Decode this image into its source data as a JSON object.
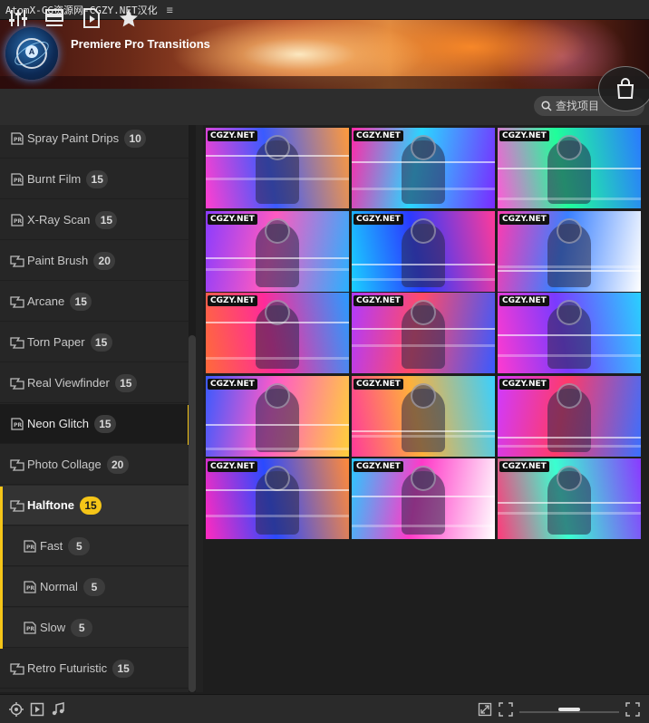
{
  "window": {
    "title": "AtomX-CG资源网-CGZY.NET汉化",
    "menu_icon": "hamburger-icon"
  },
  "banner": {
    "title": "Premiere Pro Transitions",
    "logo_letter": "A"
  },
  "toolbar": {
    "icons": [
      "sliders-icon",
      "list-icon",
      "video-file-icon",
      "star-icon"
    ],
    "search_placeholder": "查找项目",
    "cart_icon": "shopping-bag-icon"
  },
  "sidebar": {
    "items": [
      {
        "label": "Spray Paint Drips",
        "count": "10",
        "icon": "preset-icon"
      },
      {
        "label": "Burnt Film",
        "count": "15",
        "icon": "preset-icon"
      },
      {
        "label": "X-Ray Scan",
        "count": "15",
        "icon": "preset-icon"
      },
      {
        "label": "Paint Brush",
        "count": "20",
        "icon": "transition-icon"
      },
      {
        "label": "Arcane",
        "count": "15",
        "icon": "transition-icon"
      },
      {
        "label": "Torn Paper",
        "count": "15",
        "icon": "transition-icon"
      },
      {
        "label": "Real Viewfinder",
        "count": "15",
        "icon": "transition-icon"
      },
      {
        "label": "Neon Glitch",
        "count": "15",
        "icon": "preset-icon",
        "state": "selected"
      },
      {
        "label": "Photo Collage",
        "count": "20",
        "icon": "transition-icon"
      },
      {
        "label": "Halftone",
        "count": "15",
        "icon": "transition-icon",
        "state": "expanded"
      },
      {
        "label": "Fast",
        "count": "5",
        "icon": "preset-icon",
        "sub": true
      },
      {
        "label": "Normal",
        "count": "5",
        "icon": "preset-icon",
        "sub": true
      },
      {
        "label": "Slow",
        "count": "5",
        "icon": "preset-icon",
        "sub": true
      },
      {
        "label": "Retro Futuristic",
        "count": "15",
        "icon": "transition-icon"
      }
    ]
  },
  "grid": {
    "watermark": "CGZY.NET",
    "thumbnails": [
      {
        "palette": [
          "#ff3fd0",
          "#3a5bff",
          "#ff9a3c"
        ]
      },
      {
        "palette": [
          "#ff2aa8",
          "#2ad6ff",
          "#7a2aff"
        ]
      },
      {
        "palette": [
          "#ff5ad8",
          "#20ff9a",
          "#2a7aff"
        ]
      },
      {
        "palette": [
          "#8a3cff",
          "#ff5ac0",
          "#2ab0ff"
        ]
      },
      {
        "palette": [
          "#1ad0ff",
          "#2a3aff",
          "#ff3a9a"
        ]
      },
      {
        "palette": [
          "#ff3ab0",
          "#3a80ff",
          "#ffffff"
        ]
      },
      {
        "palette": [
          "#ff6a3a",
          "#ff2a9a",
          "#2a9aff"
        ]
      },
      {
        "palette": [
          "#b03aff",
          "#ff4a6a",
          "#3a5aff"
        ]
      },
      {
        "palette": [
          "#ff3ad0",
          "#7a3aff",
          "#2ad0ff"
        ]
      },
      {
        "palette": [
          "#3a5aff",
          "#ff5ac8",
          "#ffd03a"
        ]
      },
      {
        "palette": [
          "#ff3a9a",
          "#ffb03a",
          "#3ad0ff"
        ]
      },
      {
        "palette": [
          "#d03aff",
          "#ff3a6a",
          "#3a70ff"
        ]
      },
      {
        "palette": [
          "#ff2ac0",
          "#2a4aff",
          "#ff8a3a"
        ]
      },
      {
        "palette": [
          "#2ac8ff",
          "#ff3ac8",
          "#ffffff"
        ]
      },
      {
        "palette": [
          "#ff3a7a",
          "#3affd0",
          "#8a3aff"
        ]
      }
    ]
  },
  "statusbar": {
    "left_icons": [
      "target-icon",
      "play-box-icon",
      "music-note-icon"
    ],
    "right_icons": [
      "expand-icon",
      "focus-icon",
      "fullscreen-icon"
    ],
    "zoom_slider_level": 0.45
  }
}
